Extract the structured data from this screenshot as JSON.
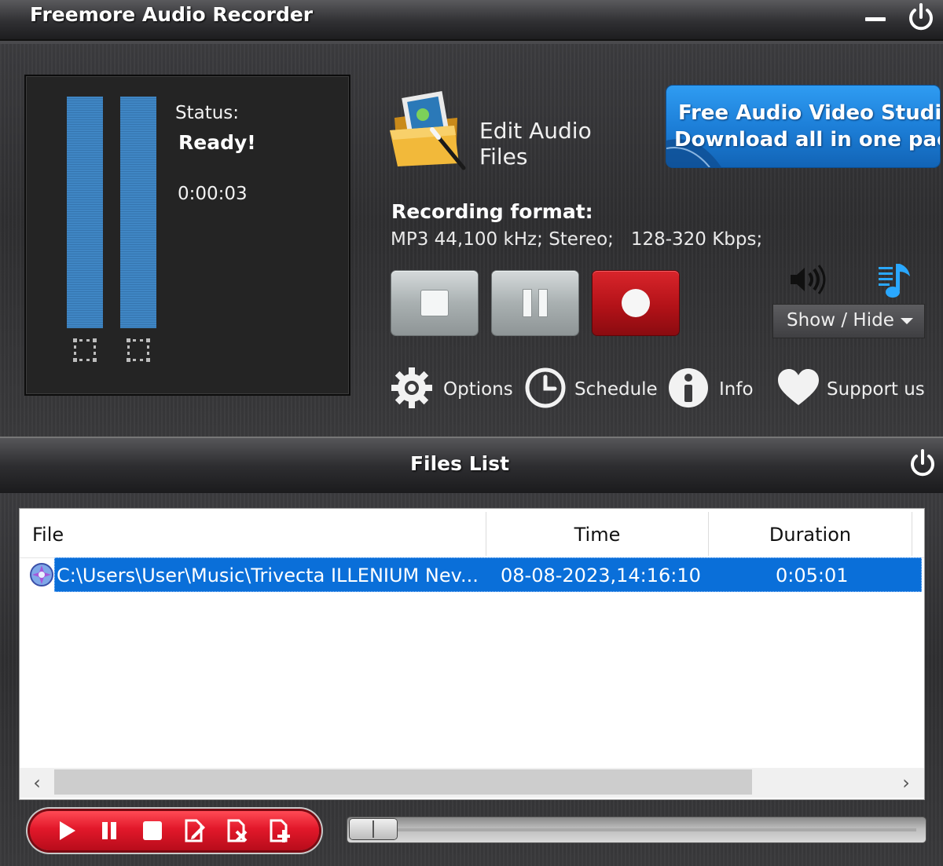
{
  "window": {
    "title": "Freemore Audio Recorder"
  },
  "meter": {
    "status_label": "Status:",
    "status_value": "Ready!",
    "elapsed": "0:00:03"
  },
  "edit": {
    "label": "Edit Audio Files"
  },
  "promo": {
    "line1": "Free Audio Video Studio",
    "line2": "Download all in one pack"
  },
  "recording": {
    "format_label": "Recording format:",
    "format_value": "MP3 44,100 kHz; Stereo;   128-320 Kbps;"
  },
  "controls": {
    "show_hide_label": "Show / Hide"
  },
  "tools": {
    "options": "Options",
    "schedule": "Schedule",
    "info": "Info",
    "support": "Support us"
  },
  "files_list": {
    "title": "Files List",
    "columns": [
      "File",
      "Time",
      "Duration"
    ],
    "rows": [
      {
        "file": "C:\\Users\\User\\Music\\Trivecta ILLENIUM Nev...",
        "time": "08-08-2023,14:16:10",
        "duration": "0:05:01"
      }
    ]
  },
  "colors": {
    "accent_blue": "#1d7fd8",
    "record_red": "#b31218",
    "selection": "#0a6fd9",
    "meter_bar": "#3f86c4"
  }
}
